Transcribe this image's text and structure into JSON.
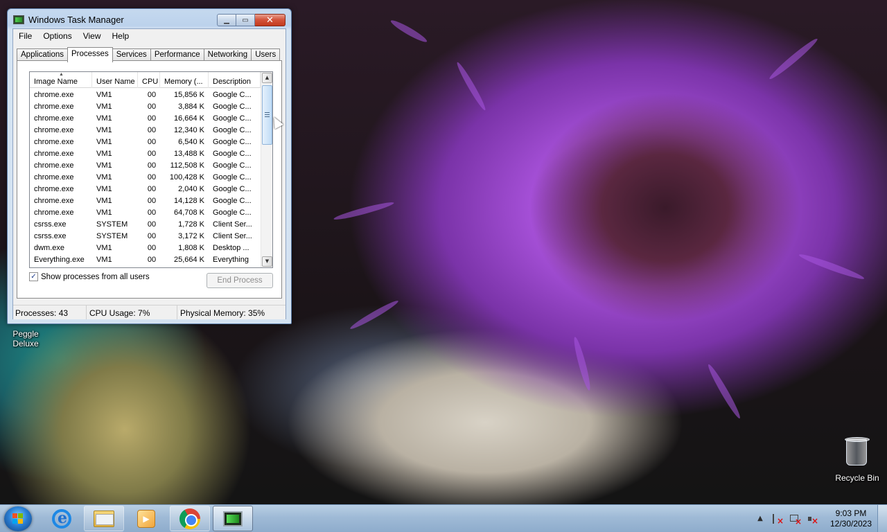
{
  "window": {
    "title": "Windows Task Manager",
    "caption_buttons": {
      "minimize": "▁",
      "maximize": "▭",
      "close": "✕"
    }
  },
  "menubar": [
    "File",
    "Options",
    "View",
    "Help"
  ],
  "tabs": [
    "Applications",
    "Processes",
    "Services",
    "Performance",
    "Networking",
    "Users"
  ],
  "active_tab": "Processes",
  "columns": [
    "Image Name",
    "User Name",
    "CPU",
    "Memory (...",
    "Description"
  ],
  "processes": [
    [
      "chrome.exe",
      "VM1",
      "00",
      "15,856 K",
      "Google C..."
    ],
    [
      "chrome.exe",
      "VM1",
      "00",
      "3,884 K",
      "Google C..."
    ],
    [
      "chrome.exe",
      "VM1",
      "00",
      "16,664 K",
      "Google C..."
    ],
    [
      "chrome.exe",
      "VM1",
      "00",
      "12,340 K",
      "Google C..."
    ],
    [
      "chrome.exe",
      "VM1",
      "00",
      "6,540 K",
      "Google C..."
    ],
    [
      "chrome.exe",
      "VM1",
      "00",
      "13,488 K",
      "Google C..."
    ],
    [
      "chrome.exe",
      "VM1",
      "00",
      "112,508 K",
      "Google C..."
    ],
    [
      "chrome.exe",
      "VM1",
      "00",
      "100,428 K",
      "Google C..."
    ],
    [
      "chrome.exe",
      "VM1",
      "00",
      "2,040 K",
      "Google C..."
    ],
    [
      "chrome.exe",
      "VM1",
      "00",
      "14,128 K",
      "Google C..."
    ],
    [
      "chrome.exe",
      "VM1",
      "00",
      "64,708 K",
      "Google C..."
    ],
    [
      "csrss.exe",
      "SYSTEM",
      "00",
      "1,728 K",
      "Client Ser..."
    ],
    [
      "csrss.exe",
      "SYSTEM",
      "00",
      "3,172 K",
      "Client Ser..."
    ],
    [
      "dwm.exe",
      "VM1",
      "00",
      "1,808 K",
      "Desktop ..."
    ],
    [
      "Everything.exe",
      "VM1",
      "00",
      "25,664 K",
      "Everything"
    ]
  ],
  "show_all_label": "Show processes from all users",
  "show_all_checked": "✓",
  "end_process_label": "End Process",
  "status": {
    "processes": "Processes: 43",
    "cpu": "CPU Usage: 7%",
    "memory": "Physical Memory: 35%"
  },
  "desktop": {
    "peggle_label_1": "Peggle",
    "peggle_label_2": "Deluxe",
    "recycle_bin_label": "Recycle Bin"
  },
  "taskbar": {
    "time": "9:03 PM",
    "date": "12/30/2023"
  },
  "colors": {
    "accent": "#a855e0",
    "taskbar": "#9fbad6"
  }
}
